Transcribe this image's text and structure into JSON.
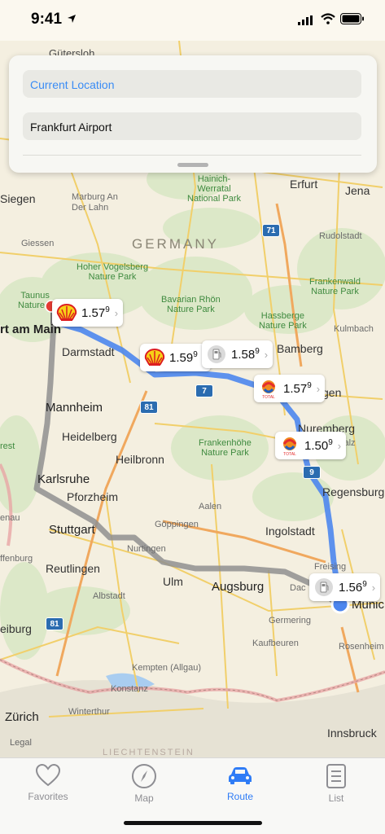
{
  "status": {
    "time": "9:41"
  },
  "search": {
    "from_value": "Current Location",
    "to_value": "Frankfurt Airport"
  },
  "map": {
    "country_label": "GERMANY",
    "labels": {
      "gutersloh": "Gütersloh",
      "siegen": "Siegen",
      "marburg": "Marburg An\nDer Lahn",
      "giessen": "Giessen",
      "vogelsberg": "Hoher Vogelsberg\nNature Park",
      "taunus": "Taunus\nNature...",
      "frankfurt": "rt am Main",
      "darmstadt": "Darmstadt",
      "mannheim": "Mannheim",
      "heidelberg": "Heidelberg",
      "karlsruhe": "Karlsruhe",
      "pforzheim": "Pforzheim",
      "heilbronn": "Heilbronn",
      "stuttgart": "Stuttgart",
      "reutlingen": "Reutlingen",
      "goppingen": "Göppingen",
      "nurtingen": "Nurtingen",
      "aalen": "Aalen",
      "albstadt": "Albstadt",
      "ulm": "Ulm",
      "augsburg": "Augsburg",
      "ingolstadt": "Ingolstadt",
      "regensburg": "Regensburg",
      "nuremberg": "Nuremberg",
      "bamberg": "Bamberg",
      "kulmbach": "Kulmbach",
      "erfurt": "Erfurt",
      "jena": "Jena",
      "rudolstadt": "Rudolstadt",
      "hainich": "Hainich-\nWerratal\nNational Park",
      "rhon": "Bavarian Rhön\nNature Park",
      "hassberge": "Hassberge\nNature Park",
      "frankenwald": "Frankenwald\nNature Park",
      "frankenhohe": "Frankenhöhe\nNature Park",
      "oberpfalz": "er Oberpfalz",
      "gen": "gen",
      "freising": "Freising",
      "dachau": "Dac",
      "munich": "Munic",
      "germering": "Germering",
      "rosenheim": "Rosenheim",
      "kaufbeuren": "Kaufbeuren",
      "kempten": "Kempten (Allgau)",
      "konstanz": "Konstanz",
      "winterthur": "Winterthur",
      "zurich": "Zürich",
      "innsbruck": "Innsbruck",
      "liechtenstein": "LIECHTENSTEIN",
      "enau": "enau",
      "ffenburg": "ffenburg",
      "eiburg": "eiburg",
      "rest": "rest"
    },
    "highways": [
      "71",
      "7",
      "81",
      "9",
      "81"
    ],
    "legal": "Legal"
  },
  "stations": [
    {
      "brand": "Shell",
      "price": "1.57",
      "sup": "9"
    },
    {
      "brand": "Shell",
      "price": "1.59",
      "sup": "9"
    },
    {
      "brand": "Generic",
      "price": "1.58",
      "sup": "9"
    },
    {
      "brand": "Total",
      "price": "1.57",
      "sup": "9"
    },
    {
      "brand": "Total",
      "price": "1.50",
      "sup": "9"
    },
    {
      "brand": "Generic",
      "price": "1.56",
      "sup": "9"
    }
  ],
  "colors": {
    "route_active": "#4d86ee",
    "route_alternate": "#8f8f8f",
    "accent": "#2f7cf6"
  },
  "tabs": [
    {
      "label": "Favorites",
      "icon": "heart-icon"
    },
    {
      "label": "Map",
      "icon": "compass-icon"
    },
    {
      "label": "Route",
      "icon": "car-icon"
    },
    {
      "label": "List",
      "icon": "list-icon"
    }
  ]
}
